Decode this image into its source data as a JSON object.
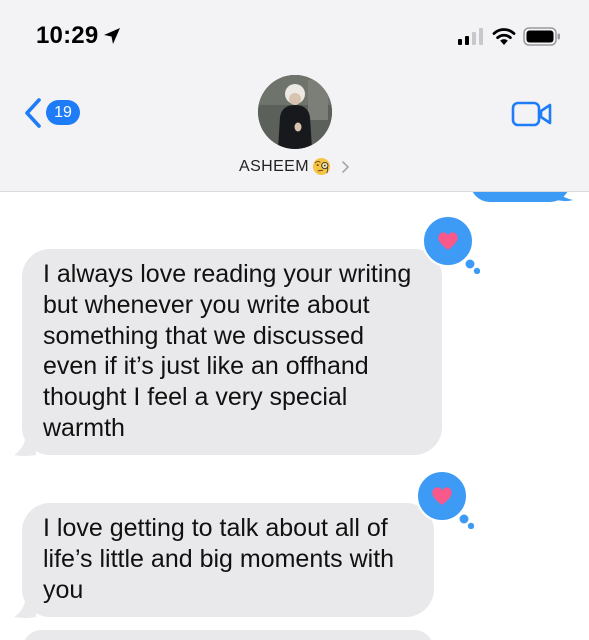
{
  "status_bar": {
    "time": "10:29",
    "icons": [
      "location-arrow-icon",
      "cellular-signal-icon",
      "wifi-icon",
      "battery-icon"
    ]
  },
  "nav": {
    "back_icon": "chevron-left-icon",
    "back_badge_count": "19",
    "contact_name": "ASHEEM",
    "contact_emoji": "face-with-monocle-emoji",
    "facetime_icon": "video-camera-icon"
  },
  "messages": [
    {
      "direction": "received",
      "text": "I always love reading your writing but whenever you write about something that we discussed even if it’s just like an offhand thought I feel a very special warmth",
      "tapback": "heart"
    },
    {
      "direction": "received",
      "text": "I love getting to talk about all of life’s little and big moments with you",
      "tapback": "heart"
    }
  ],
  "colors": {
    "accent_blue": "#1e7df6",
    "sent_bubble": "#3d9bf5",
    "received_bubble": "#e9e9eb",
    "heart": "#f8598a",
    "header_bg": "#f3f3f5"
  }
}
